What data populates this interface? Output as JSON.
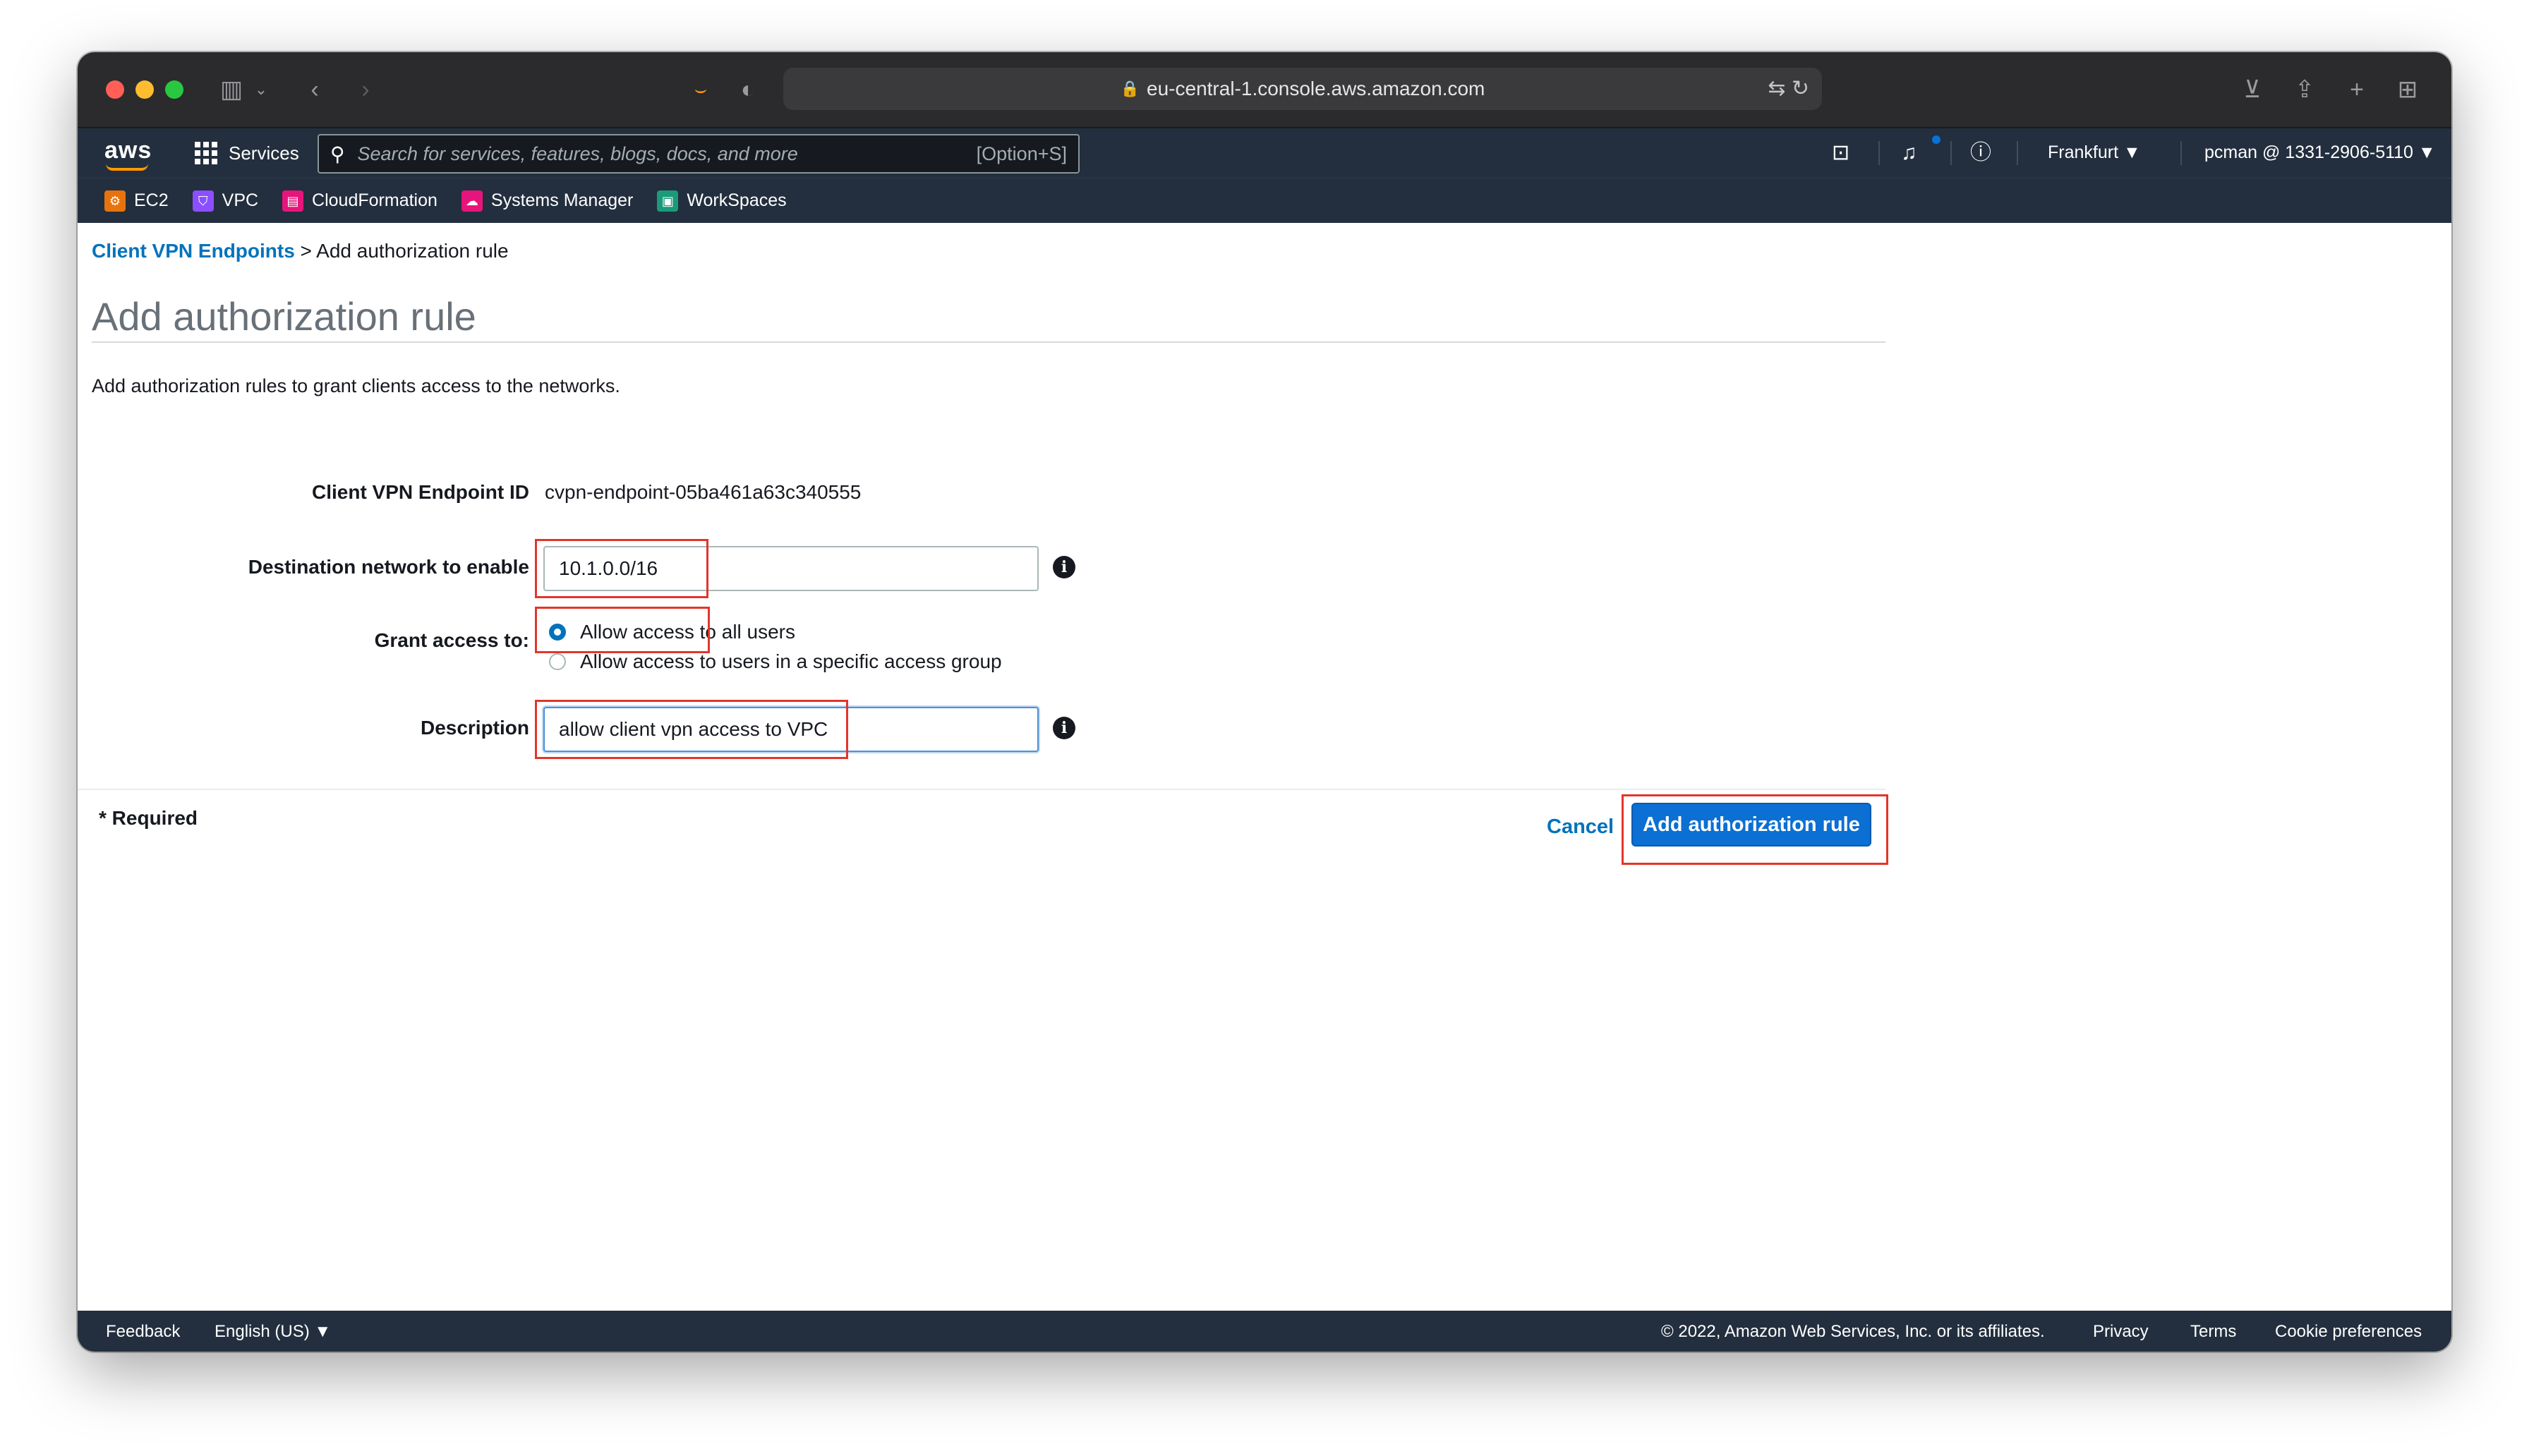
{
  "browser": {
    "url": "eu-central-1.console.aws.amazon.com"
  },
  "nav": {
    "logo": "aws",
    "services": "Services",
    "search_placeholder": "Search for services, features, blogs, docs, and more",
    "search_shortcut": "[Option+S]",
    "region": "Frankfurt ▼",
    "account": "pcman @ 1331-2906-5110 ▼"
  },
  "favorites": [
    {
      "label": "EC2",
      "color": "#e8730d"
    },
    {
      "label": "VPC",
      "color": "#8c4fff"
    },
    {
      "label": "CloudFormation",
      "color": "#e7157b"
    },
    {
      "label": "Systems Manager",
      "color": "#e7157b"
    },
    {
      "label": "WorkSpaces",
      "color": "#1b9b7a"
    }
  ],
  "breadcrumb": {
    "parent": "Client VPN Endpoints",
    "separator": " > ",
    "current": "Add authorization rule"
  },
  "page": {
    "title": "Add authorization rule",
    "description": "Add authorization rules to grant clients access to the networks."
  },
  "form": {
    "endpoint_label": "Client VPN Endpoint ID",
    "endpoint_value": "cvpn-endpoint-05ba461a63c340555",
    "destination_label": "Destination network to enable",
    "destination_value": "10.1.0.0/16",
    "grant_label": "Grant access to:",
    "grant_options": [
      {
        "label": "Allow access to all users",
        "selected": true
      },
      {
        "label": "Allow access to users in a specific access group",
        "selected": false
      }
    ],
    "description_label": "Description",
    "description_value": "allow client vpn access to VPC",
    "info_glyph": "i",
    "required_note": "* Required",
    "cancel_label": "Cancel",
    "submit_label": "Add authorization rule"
  },
  "footer": {
    "feedback": "Feedback",
    "language": "English (US) ▼",
    "copyright": "© 2022, Amazon Web Services, Inc. or its affiliates.",
    "privacy": "Privacy",
    "terms": "Terms",
    "cookies": "Cookie preferences"
  },
  "colors": {
    "nav_bg": "#232f3e",
    "link": "#0073bb",
    "primary_button": "#0b6fd3",
    "highlight": "#e3352b"
  }
}
